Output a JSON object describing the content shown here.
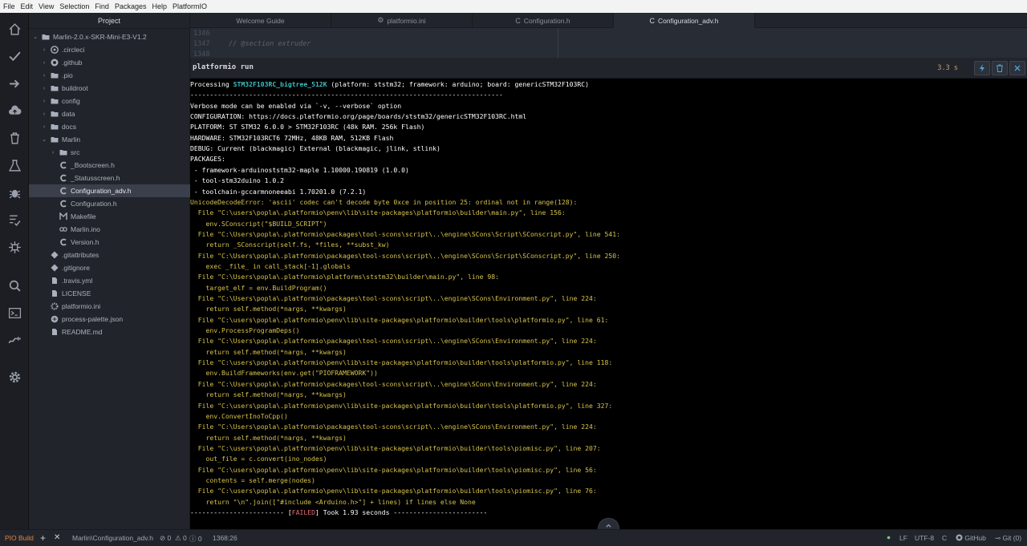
{
  "menu": [
    "File",
    "Edit",
    "View",
    "Selection",
    "Find",
    "Packages",
    "Help",
    "PlatformIO"
  ],
  "sidebar": {
    "title": "Project",
    "tree": [
      {
        "label": "Marlin-2.0.x-SKR-Mini-E3-V1.2",
        "chev": "⌄",
        "icon": "folder",
        "indent": 0
      },
      {
        "label": ".circleci",
        "chev": "›",
        "icon": "circleci",
        "indent": 1
      },
      {
        "label": ".github",
        "chev": "›",
        "icon": "github",
        "indent": 1
      },
      {
        "label": ".pio",
        "chev": "›",
        "icon": "folder",
        "indent": 1
      },
      {
        "label": "buildroot",
        "chev": "›",
        "icon": "folder",
        "indent": 1
      },
      {
        "label": "config",
        "chev": "›",
        "icon": "folder",
        "indent": 1
      },
      {
        "label": "data",
        "chev": "›",
        "icon": "folder",
        "indent": 1
      },
      {
        "label": "docs",
        "chev": "›",
        "icon": "folder",
        "indent": 1
      },
      {
        "label": "Marlin",
        "chev": "⌄",
        "icon": "folder",
        "indent": 1
      },
      {
        "label": "src",
        "chev": "›",
        "icon": "folder",
        "indent": 2
      },
      {
        "label": "_Bootscreen.h",
        "chev": "",
        "icon": "c-file",
        "indent": 2
      },
      {
        "label": "_Statusscreen.h",
        "chev": "",
        "icon": "c-file",
        "indent": 2
      },
      {
        "label": "Configuration_adv.h",
        "chev": "",
        "icon": "c-file",
        "indent": 2,
        "selected": true
      },
      {
        "label": "Configuration.h",
        "chev": "",
        "icon": "c-file",
        "indent": 2
      },
      {
        "label": "Makefile",
        "chev": "",
        "icon": "makefile",
        "indent": 2
      },
      {
        "label": "Marlin.ino",
        "chev": "",
        "icon": "arduino",
        "indent": 2
      },
      {
        "label": "Version.h",
        "chev": "",
        "icon": "c-file",
        "indent": 2
      },
      {
        "label": ".gitattributes",
        "chev": "",
        "icon": "git",
        "indent": 1
      },
      {
        "label": ".gitignore",
        "chev": "",
        "icon": "git",
        "indent": 1
      },
      {
        "label": ".travis.yml",
        "chev": "",
        "icon": "file",
        "indent": 1
      },
      {
        "label": "LICENSE",
        "chev": "",
        "icon": "file",
        "indent": 1
      },
      {
        "label": "platformio.ini",
        "chev": "",
        "icon": "gear",
        "indent": 1
      },
      {
        "label": "process-palette.json",
        "chev": "",
        "icon": "json",
        "indent": 1
      },
      {
        "label": "README.md",
        "chev": "",
        "icon": "file",
        "indent": 1
      }
    ]
  },
  "tabs": [
    {
      "label": "Welcome Guide",
      "icon": ""
    },
    {
      "label": "platformio.ini",
      "icon": "⚙"
    },
    {
      "label": "Configuration.h",
      "icon": "C"
    },
    {
      "label": "Configuration_adv.h",
      "icon": "C",
      "active": true
    }
  ],
  "editor": {
    "lines": [
      {
        "num": "1346",
        "code": ""
      },
      {
        "num": "1347",
        "code": "// @section extruder"
      },
      {
        "num": "1348",
        "code": ""
      }
    ]
  },
  "panel": {
    "title": "platformio run",
    "time": "3.3 s",
    "lines": [
      {
        "type": "processing",
        "pre": "Processing ",
        "hl": "STM32F103RC_bigtree_512K",
        "post": " (platform: ststm32; framework: arduino; board: genericSTM32F103RC)"
      },
      {
        "type": "normal",
        "text": "--------------------------------------------------------------------------------"
      },
      {
        "type": "normal",
        "text": "Verbose mode can be enabled via `-v, --verbose` option"
      },
      {
        "type": "normal",
        "text": "CONFIGURATION: https://docs.platformio.org/page/boards/ststm32/genericSTM32F103RC.html"
      },
      {
        "type": "normal",
        "text": "PLATFORM: ST STM32 6.0.0 > STM32F103RC (48k RAM. 256k Flash)"
      },
      {
        "type": "normal",
        "text": "HARDWARE: STM32F103RCT6 72MHz, 48KB RAM, 512KB Flash"
      },
      {
        "type": "normal",
        "text": "DEBUG: Current (blackmagic) External (blackmagic, jlink, stlink)"
      },
      {
        "type": "normal",
        "text": "PACKAGES:"
      },
      {
        "type": "normal",
        "text": " - framework-arduinoststm32-maple 1.10000.190819 (1.0.0)"
      },
      {
        "type": "normal",
        "text": " - tool-stm32duino 1.0.2"
      },
      {
        "type": "normal",
        "text": " - toolchain-gccarmnoneeabi 1.70201.0 (7.2.1)"
      },
      {
        "type": "err",
        "text": "UnicodeDecodeError: 'ascii' codec can't decode byte 0xce in position 25: ordinal not in range(128):"
      },
      {
        "type": "err",
        "text": "  File \"C:\\users\\popla\\.platformio\\penv\\lib\\site-packages\\platformio\\builder\\main.py\", line 156:"
      },
      {
        "type": "err",
        "text": "    env.SConscript(\"$BUILD_SCRIPT\")"
      },
      {
        "type": "err",
        "text": "  File \"C:\\Users\\popla\\.platformio\\packages\\tool-scons\\script\\..\\engine\\SCons\\Script\\SConscript.py\", line 541:"
      },
      {
        "type": "err",
        "text": "    return _SConscript(self.fs, *files, **subst_kw)"
      },
      {
        "type": "err",
        "text": "  File \"C:\\Users\\popla\\.platformio\\packages\\tool-scons\\script\\..\\engine\\SCons\\Script\\SConscript.py\", line 250:"
      },
      {
        "type": "err",
        "text": "    exec _file_ in call_stack[-1].globals"
      },
      {
        "type": "err",
        "text": "  File \"C:\\Users\\popla\\.platformio\\platforms\\ststm32\\builder\\main.py\", line 98:"
      },
      {
        "type": "err",
        "text": "    target_elf = env.BuildProgram()"
      },
      {
        "type": "err",
        "text": "  File \"C:\\Users\\popla\\.platformio\\packages\\tool-scons\\script\\..\\engine\\SCons\\Environment.py\", line 224:"
      },
      {
        "type": "err",
        "text": "    return self.method(*nargs, **kwargs)"
      },
      {
        "type": "err",
        "text": "  File \"C:\\users\\popla\\.platformio\\penv\\lib\\site-packages\\platformio\\builder\\tools\\platformio.py\", line 61:"
      },
      {
        "type": "err",
        "text": "    env.ProcessProgramDeps()"
      },
      {
        "type": "err",
        "text": "  File \"C:\\Users\\popla\\.platformio\\packages\\tool-scons\\script\\..\\engine\\SCons\\Environment.py\", line 224:"
      },
      {
        "type": "err",
        "text": "    return self.method(*nargs, **kwargs)"
      },
      {
        "type": "err",
        "text": "  File \"C:\\users\\popla\\.platformio\\penv\\lib\\site-packages\\platformio\\builder\\tools\\platformio.py\", line 118:"
      },
      {
        "type": "err",
        "text": "    env.BuildFrameworks(env.get(\"PIOFRAMEWORK\"))"
      },
      {
        "type": "err",
        "text": "  File \"C:\\Users\\popla\\.platformio\\packages\\tool-scons\\script\\..\\engine\\SCons\\Environment.py\", line 224:"
      },
      {
        "type": "err",
        "text": "    return self.method(*nargs, **kwargs)"
      },
      {
        "type": "err",
        "text": "  File \"C:\\users\\popla\\.platformio\\penv\\lib\\site-packages\\platformio\\builder\\tools\\platformio.py\", line 327:"
      },
      {
        "type": "err",
        "text": "    env.ConvertInoToCpp()"
      },
      {
        "type": "err",
        "text": "  File \"C:\\Users\\popla\\.platformio\\packages\\tool-scons\\script\\..\\engine\\SCons\\Environment.py\", line 224:"
      },
      {
        "type": "err",
        "text": "    return self.method(*nargs, **kwargs)"
      },
      {
        "type": "err",
        "text": "  File \"C:\\users\\popla\\.platformio\\penv\\lib\\site-packages\\platformio\\builder\\tools\\piomisc.py\", line 207:"
      },
      {
        "type": "err",
        "text": "    out_file = c.convert(ino_nodes)"
      },
      {
        "type": "err",
        "text": "  File \"C:\\users\\popla\\.platformio\\penv\\lib\\site-packages\\platformio\\builder\\tools\\piomisc.py\", line 56:"
      },
      {
        "type": "err",
        "text": "    contents = self.merge(nodes)"
      },
      {
        "type": "err",
        "text": "  File \"C:\\users\\popla\\.platformio\\penv\\lib\\site-packages\\platformio\\builder\\tools\\piomisc.py\", line 76:"
      },
      {
        "type": "err",
        "text": "    return \"\\n\".join([\"#include <Arduino.h>\"] + lines) if lines else None"
      },
      {
        "type": "failed",
        "pre": "------------------------ [",
        "hl": "FAILED",
        "post": "] Took 1.93 seconds ------------------------"
      }
    ]
  },
  "status": {
    "pio_build": "PIO Build",
    "add": "+",
    "close": "✕",
    "file": "Marlin\\Configuration_adv.h",
    "errors": "0",
    "warnings": "0",
    "infos": "0",
    "cursor": "1368:26",
    "line_ending": "LF",
    "encoding": "UTF-8",
    "grammar": "C",
    "github": "GitHub",
    "git": "Git (0)"
  },
  "colors": {
    "accent_cyan": "#3fbfc8",
    "error_yellow": "#d7c34b",
    "failed_red": "#e06c75",
    "pio_orange": "#e8813a"
  }
}
